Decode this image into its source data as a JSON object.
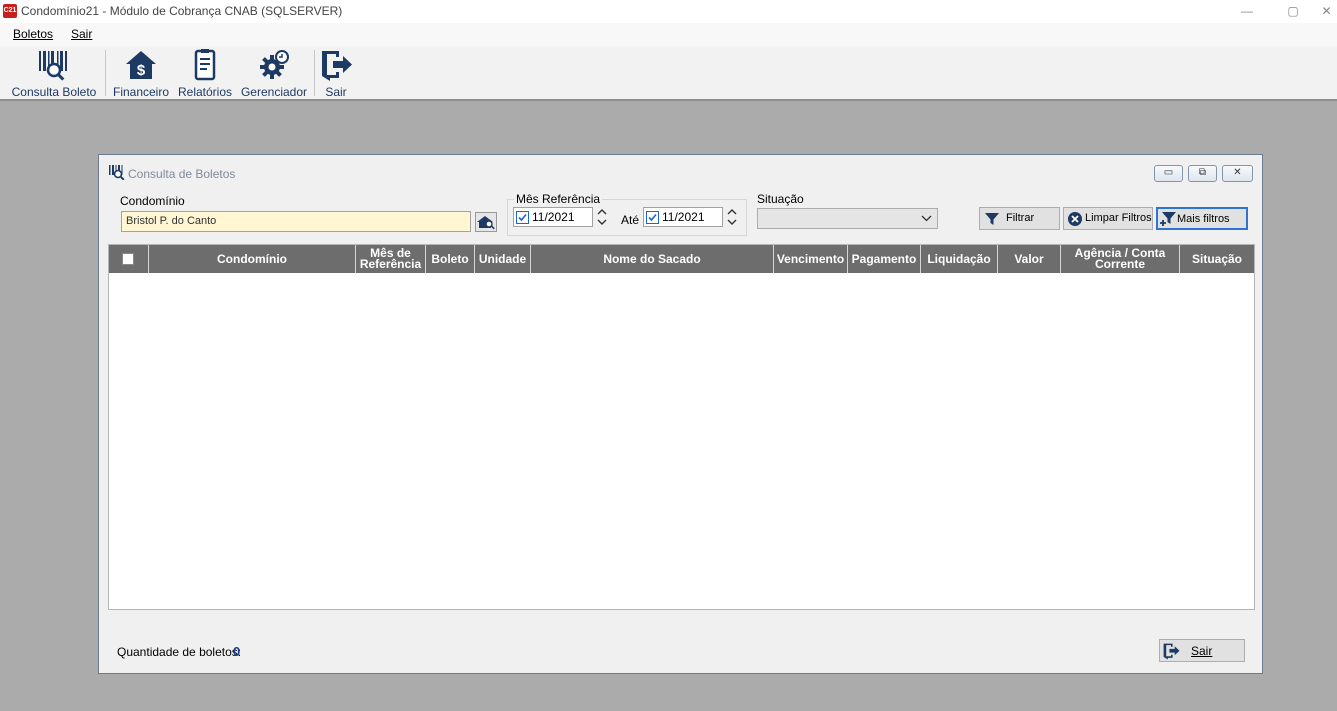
{
  "window": {
    "app_icon_text": "C21",
    "title": "Condomínio21 - Módulo de Cobrança CNAB (SQLSERVER)",
    "minimize": "—",
    "maximize": "▢",
    "close": "✕"
  },
  "menu": {
    "items": [
      {
        "label": "Boletos"
      },
      {
        "label": "Sair"
      }
    ]
  },
  "toolbar": {
    "items": [
      {
        "label": "Consulta Boleto",
        "icon": "barcode-search-icon"
      },
      {
        "label": "Financeiro",
        "icon": "house-dollar-icon"
      },
      {
        "label": "Relatórios",
        "icon": "report-icon"
      },
      {
        "label": "Gerenciador",
        "icon": "gear-icon"
      },
      {
        "label": "Sair",
        "icon": "exit-door-icon"
      }
    ],
    "icon_color": "#1d3a64"
  },
  "child_window": {
    "title": "Consulta de Boletos",
    "minimize": "▭",
    "restore": "⧉",
    "close": "✕"
  },
  "filters": {
    "condominio_label": "Condomínio",
    "condominio_value": "Bristol P. do Canto",
    "mes_referencia_label": "Mês Referência",
    "date_from": "11/2021",
    "ate_label": "Até",
    "date_to": "11/2021",
    "situacao_label": "Situação",
    "situacao_value": ""
  },
  "buttons": {
    "filtrar": "Filtrar",
    "limpar_filtros": "Limpar Filtros",
    "mais_filtros": "Mais filtros",
    "sair": "Sair"
  },
  "grid": {
    "columns": [
      "Condomínio",
      "Mês de Referência",
      "Boleto",
      "Unidade",
      "Nome do Sacado",
      "Vencimento",
      "Pagamento",
      "Liquidação",
      "Valor",
      "Agência / Conta Corrente",
      "Situação"
    ],
    "rows": []
  },
  "footer": {
    "quantidade_label": "Quantidade de boletos:",
    "quantidade_value": "0"
  },
  "colors": {
    "grid_header_bg": "#6d6d6d",
    "input_highlight": "#fff6d3",
    "count_color": "#1a3f8c"
  }
}
